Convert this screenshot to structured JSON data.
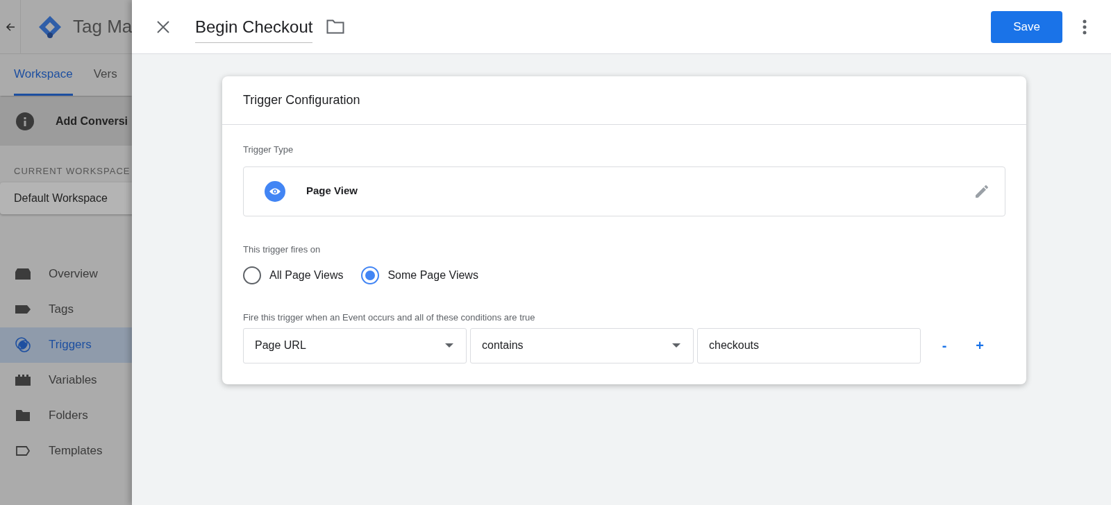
{
  "app": {
    "title": "Tag Ma",
    "tabs": [
      {
        "label": "Workspace",
        "selected": true
      },
      {
        "label": "Vers",
        "selected": false
      }
    ],
    "notice": "Add Conversi",
    "workspace_heading": "CURRENT WORKSPACE",
    "workspace": "Default Workspace",
    "nav": [
      {
        "label": "Overview",
        "kind": "overview",
        "selected": false
      },
      {
        "label": "Tags",
        "kind": "tags",
        "selected": false
      },
      {
        "label": "Triggers",
        "kind": "triggers",
        "selected": true
      },
      {
        "label": "Variables",
        "kind": "variables",
        "selected": false
      },
      {
        "label": "Folders",
        "kind": "folders",
        "selected": false
      },
      {
        "label": "Templates",
        "kind": "templates",
        "selected": false
      }
    ]
  },
  "panel": {
    "title": "Begin Checkout",
    "save": "Save"
  },
  "card": {
    "title": "Trigger Configuration",
    "type_label": "Trigger Type",
    "trigger_type": "Page View",
    "fires_label": "This trigger fires on",
    "fires_options": [
      {
        "label": "All Page Views",
        "selected": false
      },
      {
        "label": "Some Page Views",
        "selected": true
      }
    ],
    "conditions_label": "Fire this trigger when an Event occurs and all of these conditions are true",
    "condition": {
      "variable": "Page URL",
      "operator": "contains",
      "value": "checkouts"
    },
    "remove": "-",
    "add": "+"
  }
}
